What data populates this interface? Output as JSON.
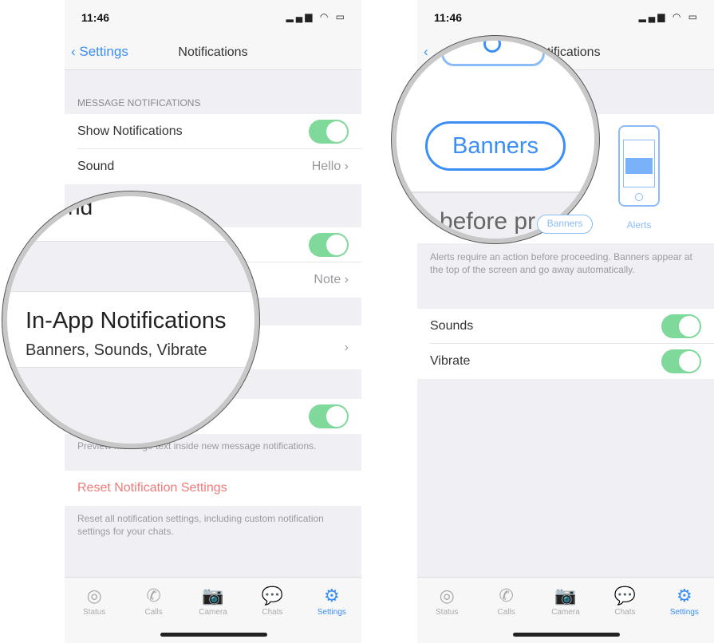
{
  "status": {
    "time": "11:46",
    "icons": "signal-wifi-battery"
  },
  "left": {
    "nav": {
      "back": "Settings",
      "title": "Notifications"
    },
    "section_header": "MESSAGE NOTIFICATIONS",
    "rows": [
      {
        "label": "Show Notifications",
        "toggle": true
      },
      {
        "label": "Sound",
        "value": "Hello"
      }
    ],
    "group_rows": [
      {
        "toggle": true
      },
      {
        "value": "Note"
      }
    ],
    "preview_footer": "Preview message text inside new message notifications.",
    "reset": "Reset Notification Settings",
    "reset_footer": "Reset all notification settings, including custom notification settings for your chats.",
    "magnifier": {
      "partial": "nd",
      "title": "In-App Notifications",
      "subtitle": "Banners, Sounds, Vibrate"
    }
  },
  "right": {
    "nav": {
      "title": "Notifications"
    },
    "styles": [
      {
        "label": "Banners",
        "selected": true
      },
      {
        "label": "Alerts",
        "selected": false
      }
    ],
    "footer": "Alerts require an action before proceeding. Banners appear at the top of the screen and go away automatically.",
    "rows": [
      {
        "label": "Sounds",
        "toggle": true
      },
      {
        "label": "Vibrate",
        "toggle": true
      }
    ],
    "magnifier": {
      "pill": "Banners",
      "partial": "before pr"
    }
  },
  "tabs": [
    {
      "label": "Status",
      "icon": "◎"
    },
    {
      "label": "Calls",
      "icon": "✆"
    },
    {
      "label": "Camera",
      "icon": "📷"
    },
    {
      "label": "Chats",
      "icon": "💬"
    },
    {
      "label": "Settings",
      "icon": "⚙",
      "active": true
    }
  ],
  "colors": {
    "accent": "#3b8ef5",
    "toggle_on": "#7fd99a",
    "destructive": "#f07a7a"
  }
}
